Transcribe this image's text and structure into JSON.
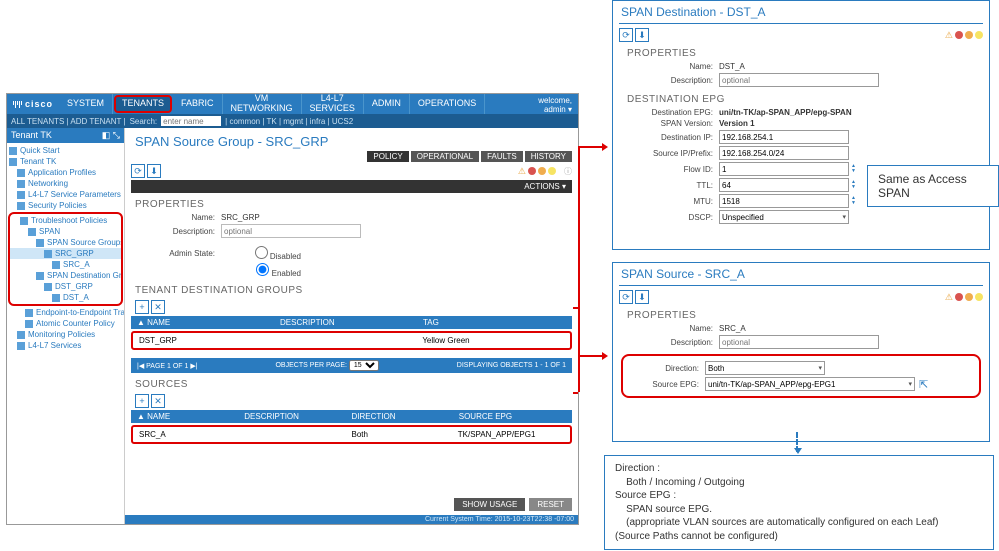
{
  "topnav": {
    "logo": "cisco",
    "tabs": [
      "SYSTEM",
      "TENANTS",
      "FABRIC",
      "VM\nNETWORKING",
      "L4-L7\nSERVICES",
      "ADMIN",
      "OPERATIONS"
    ],
    "active": "TENANTS",
    "welcome": "welcome,\nadmin ▾"
  },
  "subnav": {
    "left": "ALL TENANTS | ADD TENANT |",
    "search_label": "Search:",
    "search_placeholder": "enter name",
    "crumbs": "| common | TK | mgmt | infra | UCS2"
  },
  "tree": {
    "header": "Tenant TK",
    "nodes_top": [
      {
        "label": "Quick Start",
        "indent": 0
      },
      {
        "label": "Tenant TK",
        "indent": 0
      },
      {
        "label": "Application Profiles",
        "indent": 1
      },
      {
        "label": "Networking",
        "indent": 1
      },
      {
        "label": "L4-L7 Service Parameters",
        "indent": 1
      },
      {
        "label": "Security Policies",
        "indent": 1
      }
    ],
    "nodes_hl": [
      {
        "label": "Troubleshoot Policies",
        "indent": 1
      },
      {
        "label": "SPAN",
        "indent": 2
      },
      {
        "label": "SPAN Source Groups",
        "indent": 3
      },
      {
        "label": "SRC_GRP",
        "indent": 4,
        "selected": true
      },
      {
        "label": "SRC_A",
        "indent": 5
      },
      {
        "label": "SPAN Destination Groups",
        "indent": 3
      },
      {
        "label": "DST_GRP",
        "indent": 4
      },
      {
        "label": "DST_A",
        "indent": 5
      }
    ],
    "nodes_bot": [
      {
        "label": "Endpoint-to-Endpoint Traceroute Pol..",
        "indent": 2
      },
      {
        "label": "Atomic Counter Policy",
        "indent": 2
      },
      {
        "label": "Monitoring Policies",
        "indent": 1
      },
      {
        "label": "L4-L7 Services",
        "indent": 1
      }
    ]
  },
  "main": {
    "title": "SPAN Source Group - SRC_GRP",
    "tabs": [
      "POLICY",
      "OPERATIONAL",
      "FAULTS",
      "HISTORY"
    ],
    "actions": "ACTIONS ▾",
    "properties": "PROPERTIES",
    "name_label": "Name:",
    "name_value": "SRC_GRP",
    "desc_label": "Description:",
    "desc_placeholder": "optional",
    "admin_label": "Admin State:",
    "admin_disabled": "Disabled",
    "admin_enabled": "Enabled",
    "tdg": "TENANT DESTINATION GROUPS",
    "tdg_cols": [
      "▲ NAME",
      "DESCRIPTION",
      "TAG"
    ],
    "tdg_row": {
      "name": "DST_GRP",
      "desc": "",
      "tag": "Yellow Green"
    },
    "pager_left": "|◀  PAGE 1  OF 1  ▶|",
    "pager_mid": "OBJECTS PER PAGE:",
    "pager_sel": "15",
    "pager_right": "DISPLAYING OBJECTS 1 - 1 OF 1",
    "sources": "SOURCES",
    "src_cols": [
      "▲ NAME",
      "DESCRIPTION",
      "DIRECTION",
      "SOURCE EPG"
    ],
    "src_row": {
      "name": "SRC_A",
      "desc": "",
      "dir": "Both",
      "epg": "TK/SPAN_APP/EPG1"
    },
    "btn_show": "SHOW USAGE",
    "btn_reset": "RESET",
    "status": "Current System Time: 2015-10-23T22:38 -07:00"
  },
  "dest_panel": {
    "title": "SPAN Destination - DST_A",
    "properties": "PROPERTIES",
    "name_label": "Name:",
    "name": "DST_A",
    "desc_label": "Description:",
    "desc_ph": "optional",
    "section": "DESTINATION EPG",
    "epg_label": "Destination EPG:",
    "epg": "uni/tn-TK/ap-SPAN_APP/epg-SPAN",
    "ver_label": "SPAN Version:",
    "ver": "Version 1",
    "dip_label": "Destination IP:",
    "dip": "192.168.254.1",
    "sip_label": "Source IP/Prefix:",
    "sip": "192.168.254.0/24",
    "flow_label": "Flow ID:",
    "flow": "1",
    "ttl_label": "TTL:",
    "ttl": "64",
    "mtu_label": "MTU:",
    "mtu": "1518",
    "dscp_label": "DSCP:",
    "dscp": "Unspecified"
  },
  "src_panel": {
    "title": "SPAN Source - SRC_A",
    "properties": "PROPERTIES",
    "name_label": "Name:",
    "name": "SRC_A",
    "desc_label": "Description:",
    "desc_ph": "optional",
    "dir_label": "Direction:",
    "dir": "Both",
    "sepg_label": "Source EPG:",
    "sepg": "uni/tn-TK/ap-SPAN_APP/epg-EPG1"
  },
  "note_access": "Same as Access SPAN",
  "note_source": "Direction :\n    Both / Incoming / Outgoing\nSource EPG :\n    SPAN source EPG.\n    (appropriate VLAN sources are automatically configured on each Leaf)\n(Source Paths cannot be configured)"
}
